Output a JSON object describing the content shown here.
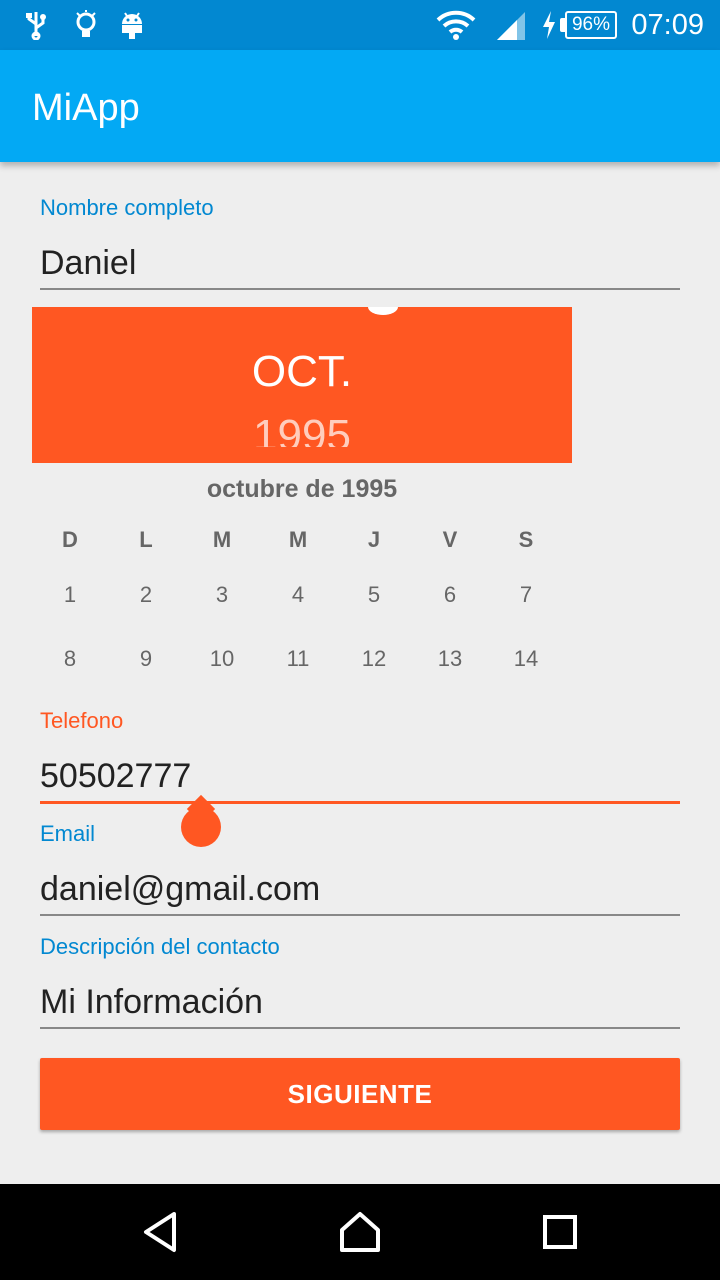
{
  "status_bar": {
    "icons": [
      "usb-icon",
      "lightbulb-icon",
      "android-icon",
      "wifi-icon",
      "signal-icon",
      "charging-icon"
    ],
    "battery": "96%",
    "time": "07:09"
  },
  "app_bar": {
    "title": "MiApp"
  },
  "form": {
    "nombre": {
      "label": "Nombre completo",
      "value": "Daniel"
    },
    "telefono": {
      "label": "Telefono",
      "value": "50502777"
    },
    "email": {
      "label": "Email",
      "value": "daniel@gmail.com"
    },
    "descripcion": {
      "label": "Descripción del contacto",
      "value": "Mi Información"
    }
  },
  "date_picker": {
    "month": "OCT.",
    "year": "1995",
    "caption": "octubre de 1995",
    "weekdays": [
      "D",
      "L",
      "M",
      "M",
      "J",
      "V",
      "S"
    ],
    "week1": [
      "1",
      "2",
      "3",
      "4",
      "5",
      "6",
      "7"
    ],
    "week2": [
      "8",
      "9",
      "10",
      "11",
      "12",
      "13",
      "14"
    ]
  },
  "actions": {
    "next_label": "SIGUIENTE"
  },
  "nav": [
    "back-icon",
    "home-icon",
    "recents-icon"
  ],
  "colors": {
    "status_bar": "#0288d1",
    "app_bar": "#03a9f4",
    "accent": "#ff5722",
    "label": "#0288d1"
  }
}
